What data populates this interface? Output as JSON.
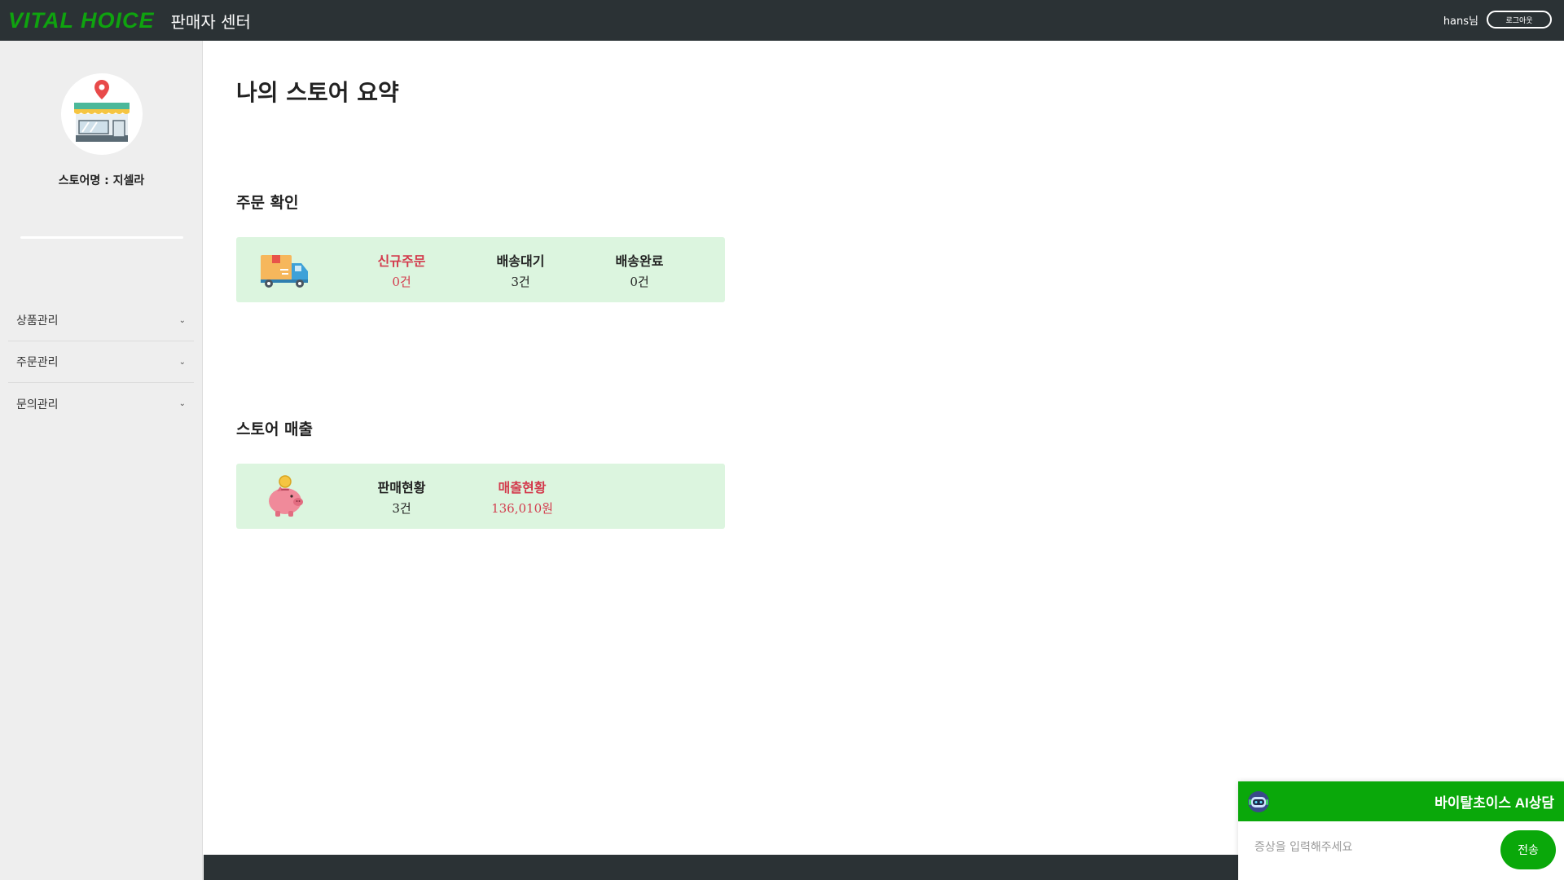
{
  "header": {
    "logo_part1": "VITAL",
    "logo_part2": "HOICE",
    "center_title": "판매자 센터",
    "user_name": "hans님",
    "logout_label": "로그아웃"
  },
  "sidebar": {
    "store_name": "스토어명 : 지셀라",
    "items": [
      {
        "label": "상품관리",
        "icon": "chevron-down-icon"
      },
      {
        "label": "주문관리",
        "icon": "chevron-down-icon"
      },
      {
        "label": "문의관리",
        "icon": "chevron-down-icon"
      }
    ]
  },
  "main": {
    "page_title": "나의 스토어 요약",
    "orders": {
      "title": "주문 확인",
      "icon": "delivery-truck-icon",
      "stats": [
        {
          "label": "신규주문",
          "value": "0건",
          "highlight": true
        },
        {
          "label": "배송대기",
          "value": "3건",
          "highlight": false
        },
        {
          "label": "배송완료",
          "value": "0건",
          "highlight": false
        }
      ]
    },
    "sales": {
      "title": "스토어 매출",
      "icon": "piggy-bank-icon",
      "stats": [
        {
          "label": "판매현황",
          "value": "3건",
          "highlight": false
        },
        {
          "label": "매출현황",
          "value": "136,010원",
          "highlight": true
        }
      ]
    }
  },
  "chat": {
    "title": "바이탈초이스 AI상담",
    "placeholder": "증상을 입력해주세요",
    "send_label": "전송"
  },
  "colors": {
    "topbar": "#2b3235",
    "brand_green": "#0aa80a",
    "card_bg": "#dcf5df",
    "highlight_red": "#d33a4c",
    "sidebar_bg": "#eeeeee"
  }
}
